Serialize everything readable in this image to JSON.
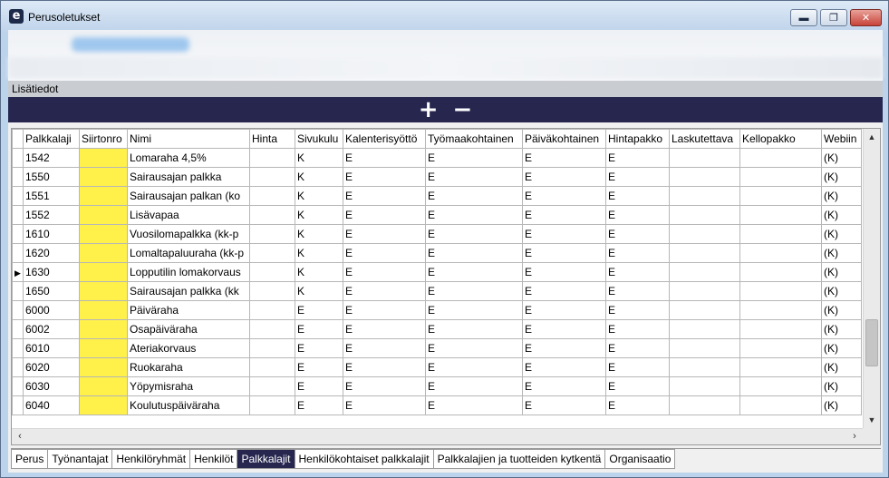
{
  "window": {
    "title": "Perusoletukset",
    "app_icon_letter": "e",
    "min_glyph": "▬",
    "max_glyph": "❐",
    "close_glyph": "✕"
  },
  "section_bar": {
    "label": "Lisätiedot"
  },
  "toolbar": {
    "add_glyph": "+",
    "remove_glyph": "−"
  },
  "grid": {
    "columns": [
      "Palkkalaji",
      "Siirtonro",
      "Nimi",
      "Hinta",
      "Sivukulu",
      "Kalenterisyöttö",
      "Työmaakohtainen",
      "Päiväkohtainen",
      "Hintapakko",
      "Laskutettava",
      "Kellopakko",
      "Webiin"
    ],
    "current_row_index": 6,
    "rows": [
      [
        "1542",
        "",
        "Lomaraha 4,5%",
        "",
        "K",
        "E",
        "E",
        "E",
        "E",
        "",
        "",
        "(K)"
      ],
      [
        "1550",
        "",
        "Sairausajan palkka",
        "",
        "K",
        "E",
        "E",
        "E",
        "E",
        "",
        "",
        "(K)"
      ],
      [
        "1551",
        "",
        "Sairausajan palkan (ko",
        "",
        "K",
        "E",
        "E",
        "E",
        "E",
        "",
        "",
        "(K)"
      ],
      [
        "1552",
        "",
        "Lisävapaa",
        "",
        "K",
        "E",
        "E",
        "E",
        "E",
        "",
        "",
        "(K)"
      ],
      [
        "1610",
        "",
        "Vuosilomapalkka (kk-p",
        "",
        "K",
        "E",
        "E",
        "E",
        "E",
        "",
        "",
        "(K)"
      ],
      [
        "1620",
        "",
        "Lomaltapaluuraha (kk-p",
        "",
        "K",
        "E",
        "E",
        "E",
        "E",
        "",
        "",
        "(K)"
      ],
      [
        "1630",
        "",
        "Lopputilin lomakorvaus",
        "",
        "K",
        "E",
        "E",
        "E",
        "E",
        "",
        "",
        "(K)"
      ],
      [
        "1650",
        "",
        "Sairausajan palkka (kk",
        "",
        "K",
        "E",
        "E",
        "E",
        "E",
        "",
        "",
        "(K)"
      ],
      [
        "6000",
        "",
        "Päiväraha",
        "",
        "E",
        "E",
        "E",
        "E",
        "E",
        "",
        "",
        "(K)"
      ],
      [
        "6002",
        "",
        "Osapäiväraha",
        "",
        "E",
        "E",
        "E",
        "E",
        "E",
        "",
        "",
        "(K)"
      ],
      [
        "6010",
        "",
        "Ateriakorvaus",
        "",
        "E",
        "E",
        "E",
        "E",
        "E",
        "",
        "",
        "(K)"
      ],
      [
        "6020",
        "",
        "Ruokaraha",
        "",
        "E",
        "E",
        "E",
        "E",
        "E",
        "",
        "",
        "(K)"
      ],
      [
        "6030",
        "",
        "Yöpymisraha",
        "",
        "E",
        "E",
        "E",
        "E",
        "E",
        "",
        "",
        "(K)"
      ],
      [
        "6040",
        "",
        "Koulutuspäiväraha",
        "",
        "E",
        "E",
        "E",
        "E",
        "E",
        "",
        "",
        "(K)"
      ]
    ]
  },
  "tabs": [
    "Perus",
    "Työnantajat",
    "Henkilöryhmät",
    "Henkilöt",
    "Palkkalajit",
    "Henkilökohtaiset palkkalajit",
    "Palkkalajien ja tuotteiden kytkentä",
    "Organisaatio"
  ],
  "active_tab": "Palkkalajit",
  "colors": {
    "toolbar_bg": "#26264f",
    "siirtonro_highlight": "#fff04a",
    "active_tab_bg": "#26264f"
  }
}
